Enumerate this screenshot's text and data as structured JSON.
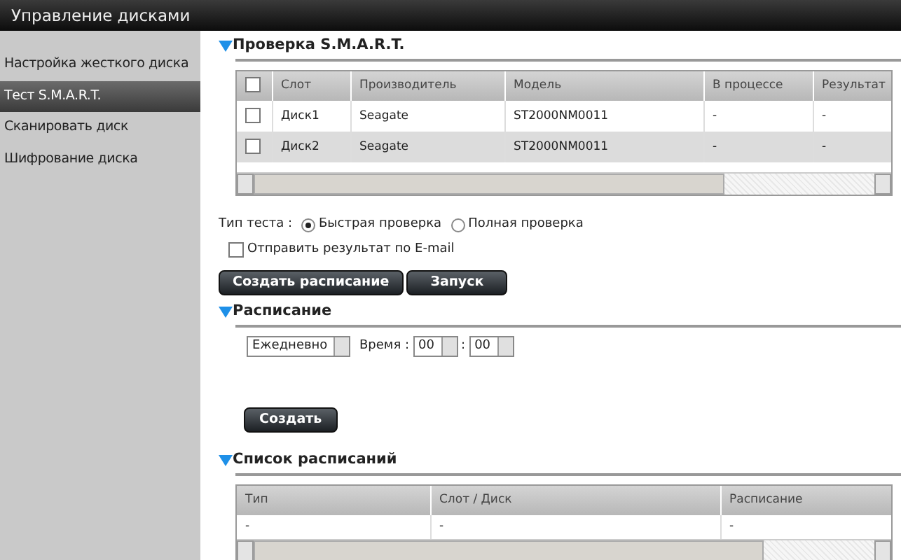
{
  "window": {
    "title": "Управление дисками"
  },
  "sidebar": {
    "items": [
      {
        "label": "Настройка жесткого диска",
        "selected": false
      },
      {
        "label": "Тест S.M.A.R.T.",
        "selected": true
      },
      {
        "label": "Сканировать диск",
        "selected": false
      },
      {
        "label": "Шифрование диска",
        "selected": false
      }
    ]
  },
  "smart_test": {
    "title": "Проверка S.M.A.R.T.",
    "table": {
      "all_checked": false,
      "columns": [
        "Слот",
        "Производитель",
        "Модель",
        "В процессе",
        "Результат"
      ],
      "rows": [
        {
          "checked": false,
          "cells": [
            "Диск1",
            "Seagate",
            "ST2000NM0011",
            "-",
            "-"
          ]
        },
        {
          "checked": false,
          "cells": [
            "Диск2",
            "Seagate",
            "ST2000NM0011",
            "-",
            "-"
          ]
        }
      ]
    },
    "test_type": {
      "label": "Тип теста :",
      "options": [
        {
          "label": "Быстрая проверка",
          "selected": true
        },
        {
          "label": "Полная проверка",
          "selected": false
        }
      ]
    },
    "email": {
      "label": "Отправить результат по E-mail",
      "checked": false
    },
    "buttons": [
      "Создать расписание",
      "Запуск"
    ]
  },
  "schedule": {
    "title": "Расписание",
    "frequency": "Ежедневно",
    "time_label": "Время :",
    "hour": "00",
    "separator": ":",
    "minute": "00",
    "buttons": [
      "Создать"
    ]
  },
  "schedule_list": {
    "title": "Список расписаний",
    "columns": [
      "Тип",
      "Слот / Диск",
      "Расписание"
    ],
    "rows": [
      [
        "-",
        "-",
        "-"
      ]
    ]
  }
}
